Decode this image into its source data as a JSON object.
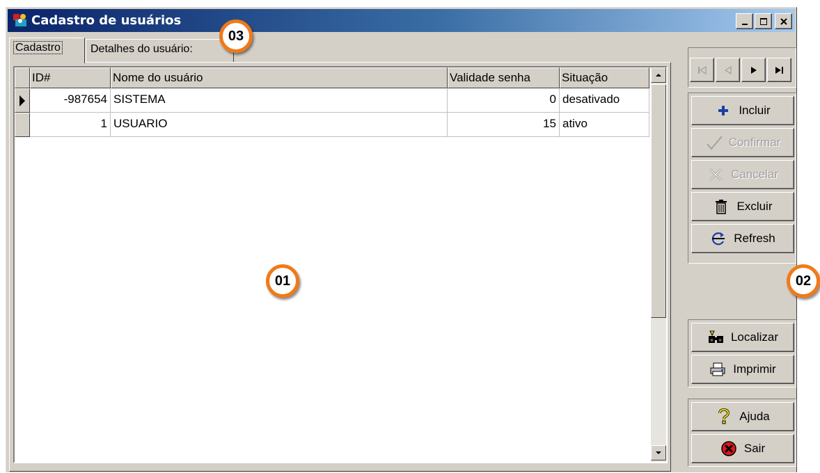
{
  "window": {
    "title": "Cadastro de usuários",
    "minimize_label": "Minimizar",
    "maximize_label": "Maximizar",
    "close_label": "Fechar"
  },
  "tabs": [
    {
      "label": "Cadastro",
      "active": true
    },
    {
      "label": "Detalhes do usuário:",
      "active": false
    }
  ],
  "grid": {
    "columns": [
      "ID#",
      "Nome do usuário",
      "Validade senha",
      "Situação"
    ],
    "rows": [
      {
        "id": "-987654",
        "name": "SISTEMA",
        "validade": "0",
        "situacao": "desativado",
        "current": true
      },
      {
        "id": "1",
        "name": "USUARIO",
        "validade": "15",
        "situacao": "ativo",
        "current": false
      }
    ]
  },
  "navigator": {
    "buttons": [
      {
        "name": "first",
        "enabled": false
      },
      {
        "name": "prior",
        "enabled": false
      },
      {
        "name": "next",
        "enabled": true
      },
      {
        "name": "last",
        "enabled": true
      }
    ]
  },
  "actions": {
    "incluir": {
      "label": "Incluir",
      "icon": "plus-icon",
      "enabled": true
    },
    "confirmar": {
      "label": "Confirmar",
      "icon": "check-icon",
      "enabled": false
    },
    "cancelar": {
      "label": "Cancelar",
      "icon": "cancel-x-icon",
      "enabled": false
    },
    "excluir": {
      "label": "Excluir",
      "icon": "trash-icon",
      "enabled": true
    },
    "refresh": {
      "label": "Refresh",
      "icon": "refresh-icon",
      "enabled": true
    },
    "localizar": {
      "label": "Localizar",
      "icon": "binoculars-icon",
      "enabled": true
    },
    "imprimir": {
      "label": "Imprimir",
      "icon": "printer-icon",
      "enabled": true
    },
    "ajuda": {
      "label": "Ajuda",
      "icon": "question-icon",
      "enabled": true
    },
    "sair": {
      "label": "Sair",
      "icon": "stop-icon",
      "enabled": true
    }
  },
  "callouts": {
    "c01": "01",
    "c02": "02",
    "c03": "03"
  },
  "colors": {
    "callout_border": "#f07a18",
    "title_gradient_start": "#0a246a",
    "title_gradient_end": "#a6caf0",
    "face": "#d4d0c8"
  }
}
